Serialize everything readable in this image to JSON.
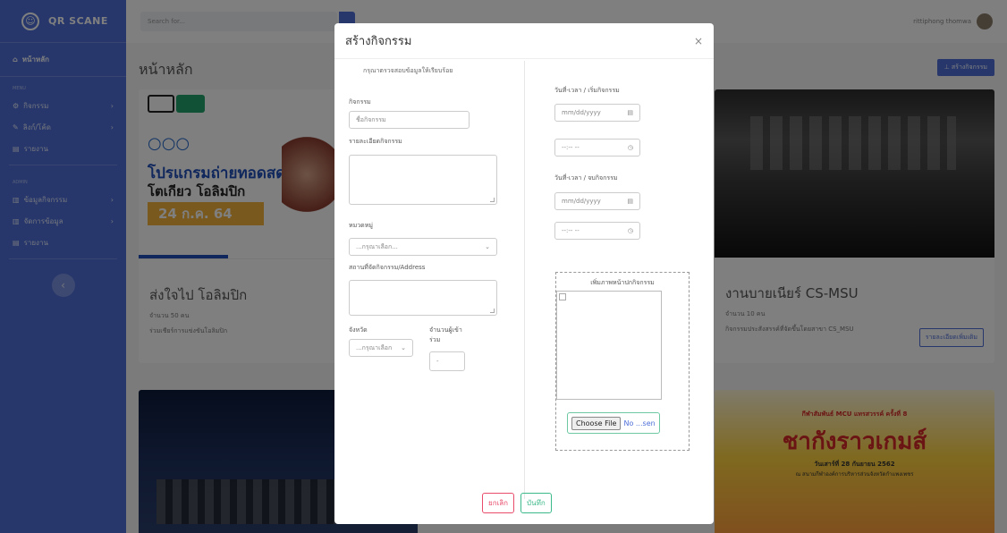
{
  "brand": {
    "name": "QR SCANE"
  },
  "sidebar": {
    "home": "หน้าหลัก",
    "heading_menu": "MENU",
    "heading_admin": "ADMIN",
    "items": [
      {
        "label": "กิจกรรม"
      },
      {
        "label": "ลิงก์/โค้ด"
      },
      {
        "label": "รายงาน"
      }
    ],
    "admin_items": [
      {
        "label": "ข้อมูลกิจกรรม"
      },
      {
        "label": "จัดการข้อมูล"
      },
      {
        "label": "รายงาน"
      }
    ]
  },
  "topbar": {
    "search_placeholder": "Search for...",
    "user_name": "rittiphong thomwa"
  },
  "page": {
    "title": "หน้าหลัก",
    "create_button": "สร้างกิจกรรม"
  },
  "cards": [
    {
      "title": "ส่งใจไป โอลิมปิก",
      "count": "จำนวน 50 คน",
      "desc": "ร่วมเชียร์การแข่งขันโอลิมปิก",
      "image_text_1": "โปรแกรมถ่ายทอดสด",
      "image_text_2": "โตเกียว โอลิมปิก",
      "image_text_3": "24 ก.ค. 64"
    },
    {
      "title": "งานบายเนียร์ CS-MSU",
      "count": "จำนวน 10 คน",
      "desc": "กิจกรรมประสังสรรค์ที่จัดขึ้นโดยสาขา CS_MSU",
      "button": "รายละเอียดเพิ่มเติม"
    },
    {
      "image_text_1": "กีฬาสัมพันธ์ MCU แทรสวรรค์ ครั้งที่ 8",
      "image_text_2": "ชากังราวเกมส์",
      "image_text_3": "วันเสาร์ที่ 28 กันยายน 2562",
      "image_text_4": "ณ สนามกีฬาองค์การบริหารส่วนจังหวัดกำแพงเพชร"
    }
  ],
  "modal": {
    "title": "สร้างกิจกรรม",
    "close": "×",
    "note": "กรุณาตรวจสอบข้อมูลให้เรียบร้อย",
    "activity_label": "กิจกรรม",
    "activity_placeholder": "ชื่อกิจกรรม",
    "detail_label": "รายละเอียดกิจกรรม",
    "category_label": "หมวดหมู่",
    "category_value": "...กรุณาเลือก...",
    "location_label": "สถานที่จัดกิจกรรม/Address",
    "province_label": "จังหวัด",
    "province_value": "...กรุณาเลือก",
    "participants_label_1": "จำนวนผู้เข้า",
    "participants_label_2": "ร่วม",
    "participants_value": "-",
    "start_label": "วันที่-เวลา / เริ่มกิจกรรม",
    "end_label": "วันที่-เวลา / จบกิจกรรม",
    "date_placeholder": "mm/dd/yyyy",
    "time_placeholder": "--:-- --",
    "image_caption": "เพิ่มภาพหน้าปกกิจกรรม",
    "file_button": "Choose File",
    "file_status": "No ...sen",
    "cancel": "ยกเลิก",
    "save": "บันทึก"
  },
  "colors": {
    "primary": "#4e6fd9",
    "danger": "#e94c6b",
    "success": "#3cb98a"
  }
}
